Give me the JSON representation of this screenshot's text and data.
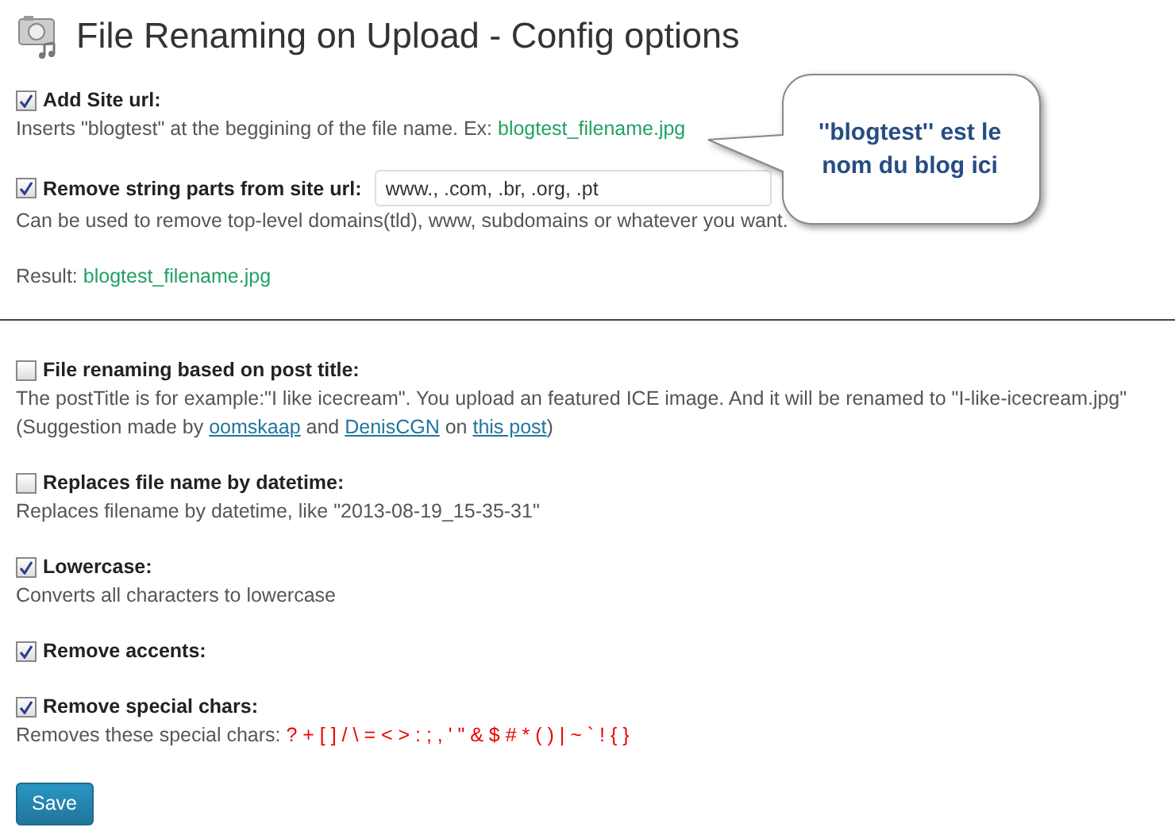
{
  "page_title": "File Renaming on Upload - Config options",
  "callout": {
    "text": "''blogtest'' est le nom du blog ici"
  },
  "sections": [
    {
      "options": [
        {
          "label": "Add Site url:",
          "checked": true,
          "lines": [
            [
              {
                "kind": "text",
                "text": "Inserts \"blogtest\" at the beggining of the file name. Ex: "
              },
              {
                "kind": "example",
                "text": "blogtest_filename.jpg"
              }
            ]
          ]
        },
        {
          "label": "Remove string parts from site url:",
          "checked": true,
          "input_value": "www., .com, .br, .org, .pt",
          "lines": [
            [
              {
                "kind": "text",
                "text": "Can be used to remove top-level domains(tld), www, subdomains or whatever you want."
              }
            ]
          ]
        }
      ],
      "result": {
        "label": "Result: ",
        "value": "blogtest_filename.jpg"
      }
    },
    {
      "options": [
        {
          "label": "File renaming based on post title:",
          "checked": false,
          "lines": [
            [
              {
                "kind": "text",
                "text": "The postTitle is for example:\"I like icecream\". You upload an featured ICE image. And it will be renamed to \"I-like-icecream.jpg\""
              }
            ],
            [
              {
                "kind": "text",
                "text": "(Suggestion made by "
              },
              {
                "kind": "link",
                "text": "oomskaap"
              },
              {
                "kind": "text",
                "text": " and "
              },
              {
                "kind": "link",
                "text": "DenisCGN"
              },
              {
                "kind": "text",
                "text": " on "
              },
              {
                "kind": "link",
                "text": "this post"
              },
              {
                "kind": "text",
                "text": ")"
              }
            ]
          ]
        },
        {
          "label": "Replaces file name by datetime:",
          "checked": false,
          "lines": [
            [
              {
                "kind": "text",
                "text": "Replaces filename by datetime, like \"2013-08-19_15-35-31\""
              }
            ]
          ]
        },
        {
          "label": "Lowercase:",
          "checked": true,
          "lines": [
            [
              {
                "kind": "text",
                "text": "Converts all characters to lowercase"
              }
            ]
          ]
        },
        {
          "label": "Remove accents:",
          "checked": true
        },
        {
          "label": "Remove special chars:",
          "checked": true,
          "lines": [
            [
              {
                "kind": "text",
                "text": "Removes these special chars: "
              },
              {
                "kind": "special",
                "text": "? + [ ] / \\ = < > : ; , ' \" & $ # * ( ) | ~ ` ! { }"
              }
            ]
          ]
        }
      ]
    }
  ],
  "save_button": "Save"
}
